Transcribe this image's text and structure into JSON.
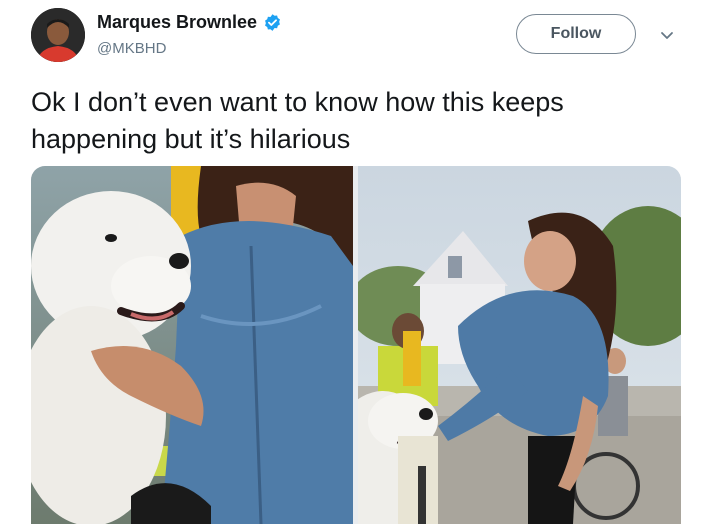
{
  "user": {
    "display_name": "Marques Brownlee",
    "handle": "@MKBHD",
    "verified": true
  },
  "actions": {
    "follow_label": "Follow"
  },
  "tweet": {
    "text": "Ok I don’t even want to know how this keeps happening but it’s hilarious"
  },
  "icons": {
    "verified": "verified-badge-icon",
    "more": "chevron-down-icon"
  },
  "colors": {
    "verified_blue": "#1da1f2",
    "handle_gray": "#657786",
    "text": "#14171a"
  }
}
